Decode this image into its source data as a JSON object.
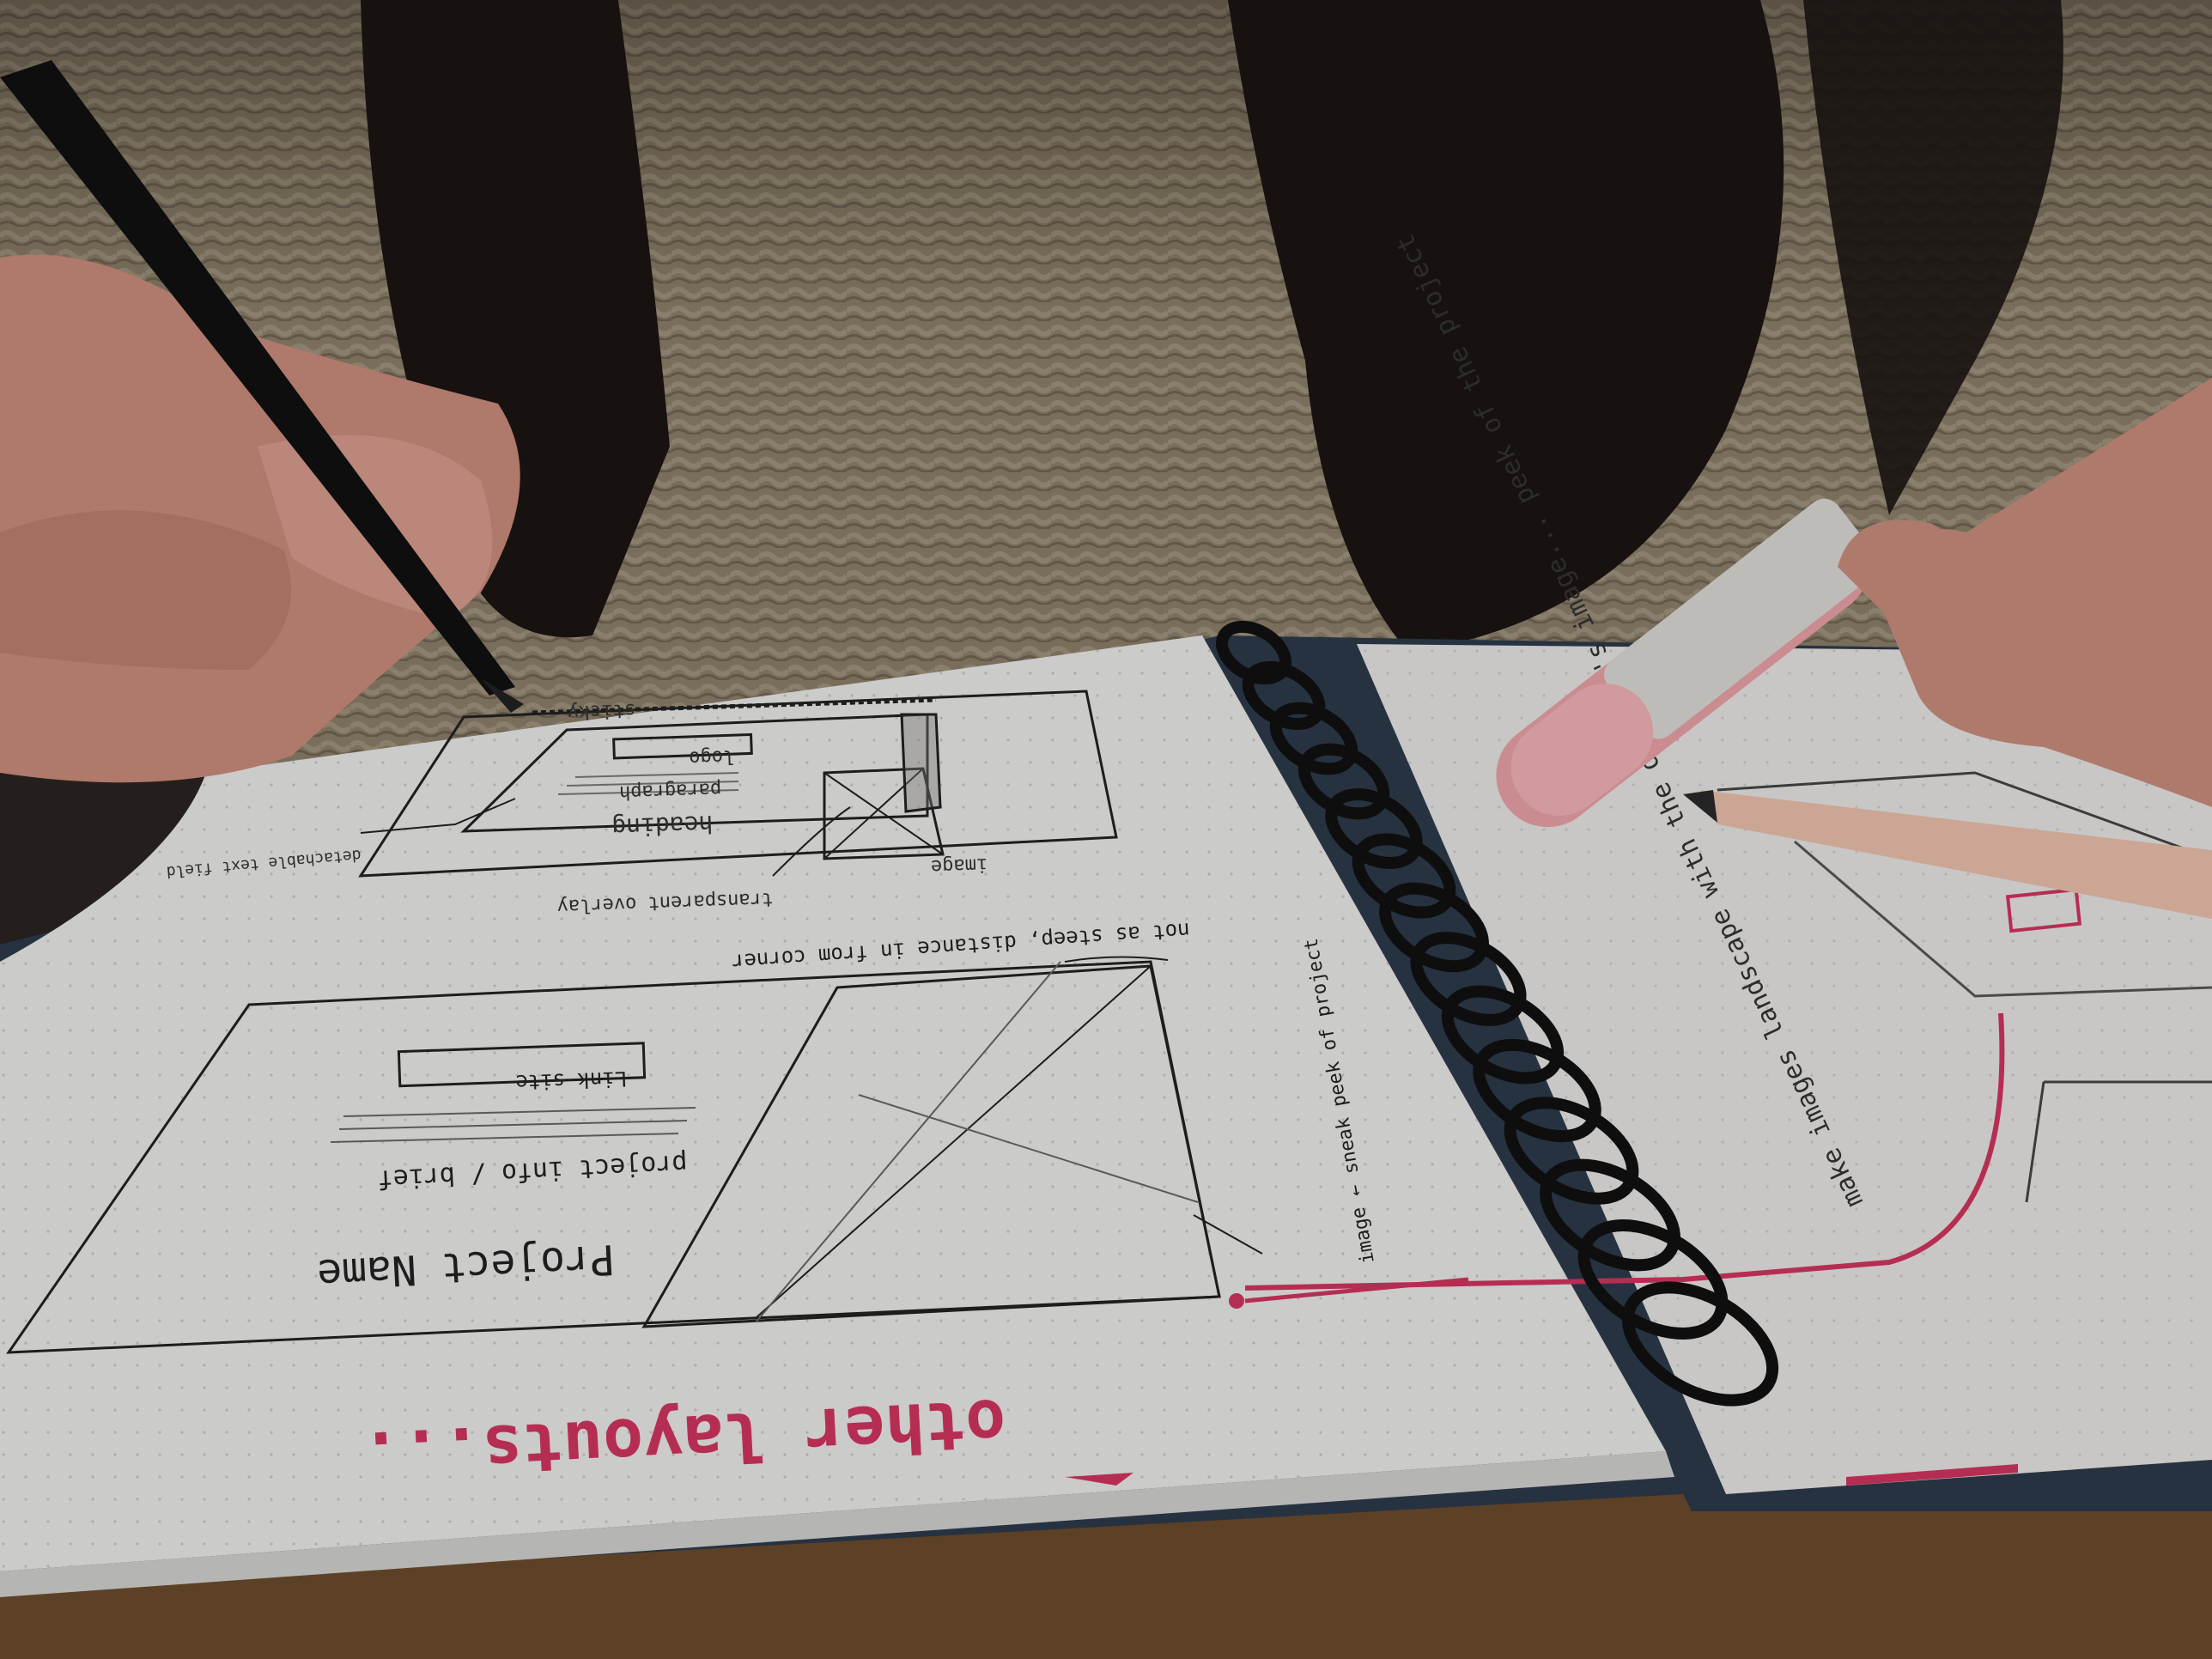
{
  "colors": {
    "sweater": "#8c7f6a",
    "hair": "#1a1412",
    "table": "#6b4a2c",
    "paper": "#e9e8e6",
    "ink": "#222222",
    "accent_pink": "#d0345f",
    "marker_pink": "#e8a3a7",
    "pencil": "#e9bfae",
    "skin": "#c98f80"
  },
  "notebook": {
    "left_page": {
      "heading": "other layouts...",
      "top_sketch": {
        "labels": {
          "sticky": "sticky",
          "logo": "logo",
          "paragraph": "paragraph",
          "heading": "heading",
          "image": "image",
          "transparent_overlay": "transparent overlay",
          "side_text": "detachable text field"
        }
      },
      "bottom_sketch": {
        "note": "not as steep, distance in from corner",
        "project_name": "Project Name",
        "project_info": "project info / brief",
        "link_button": "Link site",
        "image_note": "image ← sneak peek of project"
      }
    },
    "right_page": {
      "notes": "make images landscape with the overlay's image... peek of the project"
    }
  },
  "objects": {
    "pen": "black-pen",
    "marker": "pink-sharpie-marker",
    "pencil": "pencil",
    "spiral": "spiral-binding"
  }
}
